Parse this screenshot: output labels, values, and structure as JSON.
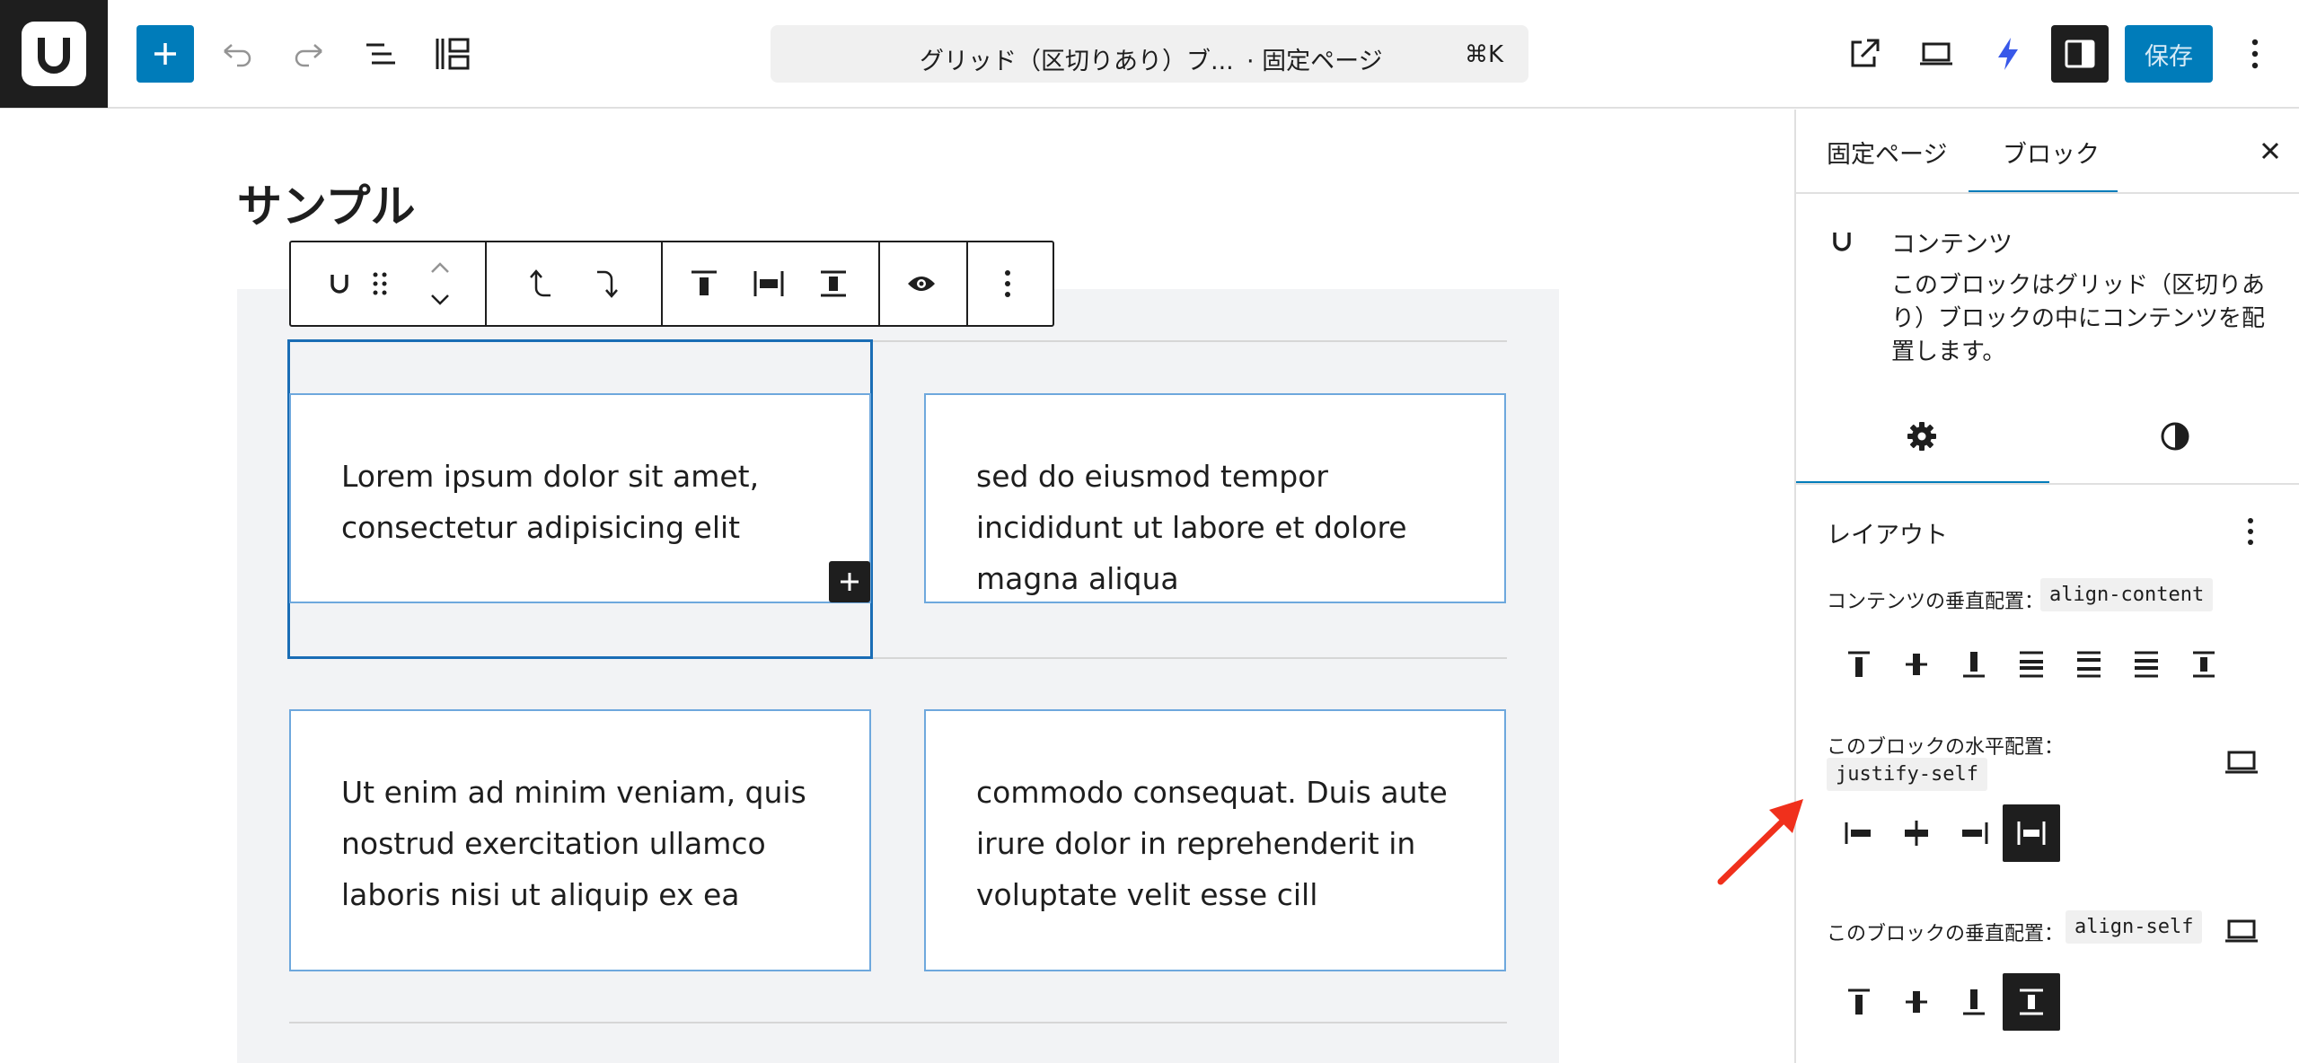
{
  "topbar": {
    "site_icon": "site-logo-u",
    "add_label": "+",
    "doc_title": "グリッド（区切りあり）ブ...",
    "doc_type": "· 固定ページ",
    "shortcut": "⌘K",
    "save_label": "保存",
    "icons": [
      "plus-icon",
      "undo-icon",
      "redo-icon",
      "list-view-icon",
      "block-outline-icon",
      "external-link-icon",
      "device-preview-icon",
      "bolt-icon",
      "sidebar-toggle-icon",
      "more-vertical-icon"
    ]
  },
  "canvas": {
    "page_title": "サンプル",
    "cells": [
      "Lorem ipsum dolor sit amet, consectetur adipisicing elit",
      "sed do eiusmod tempor incididunt ut labore et dolore magna aliqua",
      "Ut enim ad minim veniam, quis nostrud exercitation ullamco laboris nisi ut aliquip ex ea",
      "commodo consequat. Duis aute irure dolor in reprehenderit in voluptate velit esse cill"
    ]
  },
  "sidebar": {
    "tabs": [
      "固定ページ",
      "ブロック"
    ],
    "active_tab": "ブロック",
    "block_name": "コンテンツ",
    "block_desc": "このブロックはグリッド（区切りあり）ブロックの中にコンテンツを配置します。",
    "panel_title": "レイアウト",
    "align_content_label": "コンテンツの垂直配置：",
    "align_content_code": "align-content",
    "justify_self_label": "このブロックの水平配置：",
    "justify_self_code": "justify-self",
    "align_self_label": "このブロックの垂直配置：",
    "align_self_code": "align-self",
    "justify_self_active": "stretch",
    "align_self_active": "stretch"
  },
  "colors": {
    "accent": "#007cba",
    "dark": "#1e1e1e",
    "cell_border": "#6ea8dd",
    "annotation_arrow": "#f0301c"
  }
}
